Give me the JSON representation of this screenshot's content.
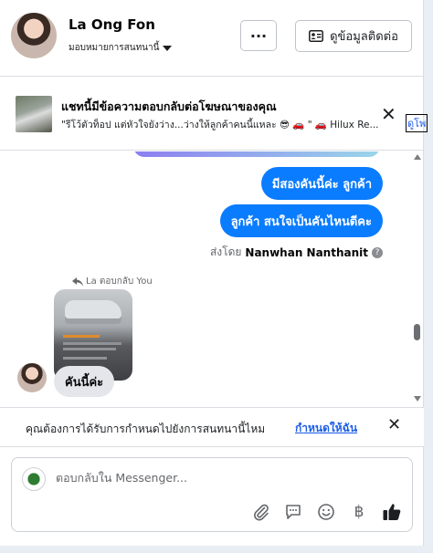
{
  "header": {
    "name": "La Ong Fon",
    "assign_label": "มอบหมายการสนทนานี้",
    "more_label": "···",
    "contact_label": "ดูข้อมูลติดต่อ"
  },
  "notice": {
    "title": "แชทนี้มีข้อความตอบกลับต่อโฆษณาของคุณ",
    "text": "\"รีโว้ตัวท็อป แต่หัวใจยังว่าง...ว่างให้ลูกค้าคนนี้แหละ 😎 🚗 \" 🚗 Hilux Re...",
    "link": "ดูโพสต์"
  },
  "messages": {
    "out1": "มีสองคันนี้ค่ะ  ลูกค้า",
    "out2": "ลูกค้า  สนใจเป็นคันไหนดีคะ",
    "sent_by_prefix": "ส่งโดย",
    "sent_by_name": "Nanwhan Nanthanit",
    "info": "?",
    "reply_label": "La ตอบกลับ You",
    "in1": "คันนี้ค่ะ"
  },
  "assign_prompt": {
    "text": "คุณต้องการได้รับการกำหนดไปยังการสนทนานี้ไหม",
    "link": "กำหนดให้ฉัน"
  },
  "composer": {
    "placeholder": "ตอบกลับใน Messenger...",
    "icons": [
      "paperclip-icon",
      "speech-bubble-icon",
      "smiley-icon",
      "baht-icon",
      "thumbs-up-icon"
    ]
  },
  "colors": {
    "outgoing_bubble": "#0a7cff",
    "incoming_bubble": "#e4e6eb",
    "link": "#1c5ee6",
    "like": "#1c1e21"
  }
}
